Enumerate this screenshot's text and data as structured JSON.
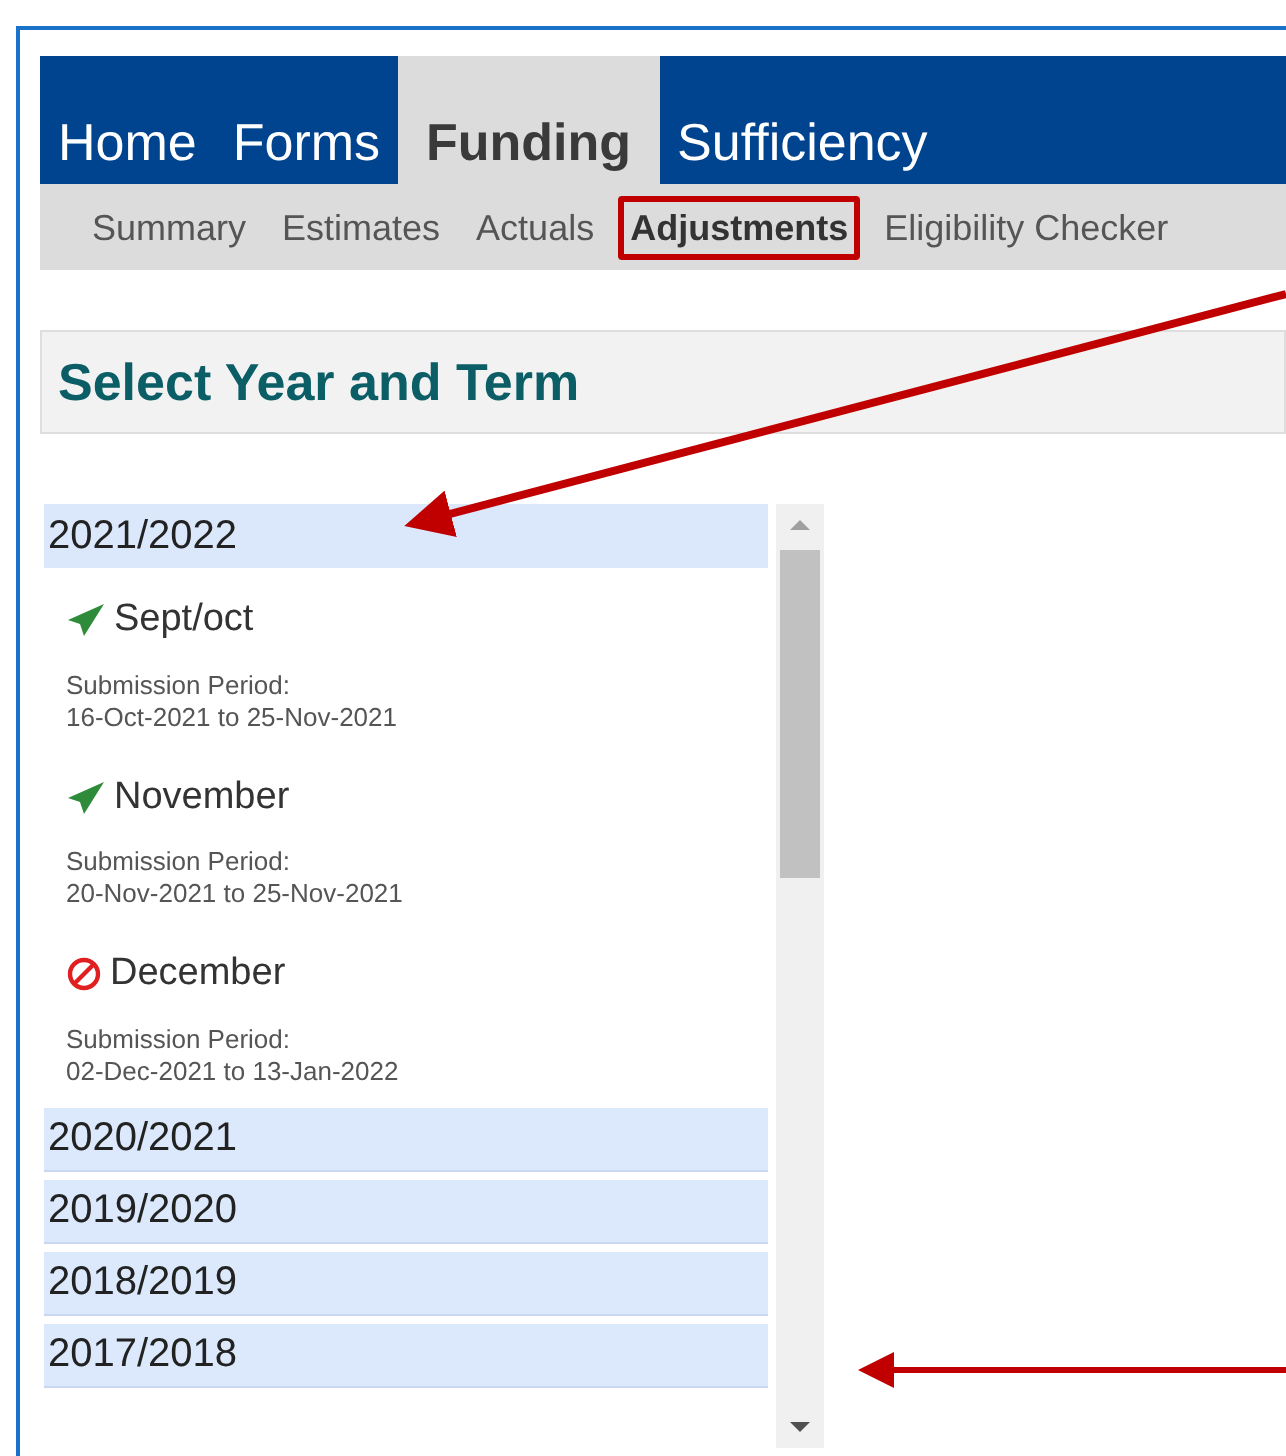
{
  "nav": {
    "tabs": [
      {
        "label": "Home",
        "selected": false
      },
      {
        "label": "Forms",
        "selected": false
      },
      {
        "label": "Funding",
        "selected": true
      },
      {
        "label": "Sufficiency",
        "selected": false
      }
    ],
    "subtabs": [
      {
        "label": "Summary",
        "selected": false,
        "highlighted": false
      },
      {
        "label": "Estimates",
        "selected": false,
        "highlighted": false
      },
      {
        "label": "Actuals",
        "selected": false,
        "highlighted": false
      },
      {
        "label": "Adjustments",
        "selected": true,
        "highlighted": true
      },
      {
        "label": "Eligibility Checker",
        "selected": false,
        "highlighted": false
      }
    ]
  },
  "panel": {
    "title": "Select Year and Term"
  },
  "years": [
    {
      "label": "2021/2022",
      "expanded": true,
      "terms": [
        {
          "name": "Sept/oct",
          "kind": "sent",
          "period_label": "Submission Period:",
          "period": "16-Oct-2021 to 25-Nov-2021"
        },
        {
          "name": "November",
          "kind": "sent",
          "period_label": "Submission Period:",
          "period": "20-Nov-2021 to 25-Nov-2021"
        },
        {
          "name": "December",
          "kind": "blocked",
          "period_label": "Submission Period:",
          "period": "02-Dec-2021 to 13-Jan-2022"
        }
      ]
    },
    {
      "label": "2020/2021",
      "expanded": false
    },
    {
      "label": "2019/2020",
      "expanded": false
    },
    {
      "label": "2018/2019",
      "expanded": false
    },
    {
      "label": "2017/2018",
      "expanded": false
    }
  ]
}
